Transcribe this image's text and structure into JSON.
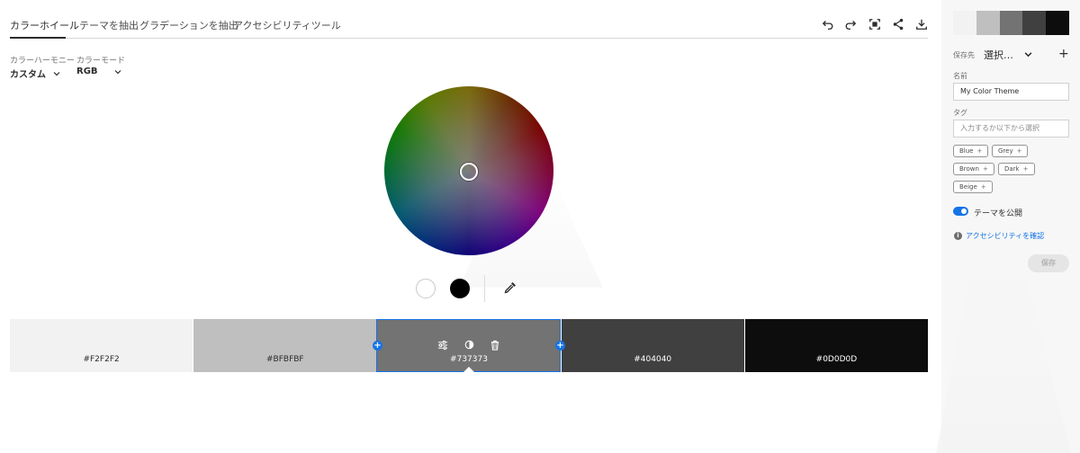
{
  "tabs": [
    {
      "label": "カラーホイール",
      "active": true
    },
    {
      "label": "テーマを抽出",
      "active": false
    },
    {
      "label": "グラデーションを抽出",
      "active": false
    },
    {
      "label": "アクセシビリティツール",
      "active": false
    }
  ],
  "toolbar": {
    "icons": [
      "undo-icon",
      "redo-icon",
      "fullscreen-icon",
      "share-icon",
      "download-icon"
    ]
  },
  "harmony": {
    "label": "カラーハーモニー",
    "value": "カスタム"
  },
  "mode": {
    "label": "カラーモード",
    "value": "RGB"
  },
  "wheel": {
    "base_colors": [
      {
        "name": "white",
        "color": "#FFFFFF"
      },
      {
        "name": "black",
        "color": "#000000"
      }
    ]
  },
  "swatches": [
    {
      "hex": "#F2F2F2",
      "color": "#F2F2F2",
      "text_color": "#2c2c2c",
      "selected": false
    },
    {
      "hex": "#BFBFBF",
      "color": "#BFBFBF",
      "text_color": "#2c2c2c",
      "selected": false
    },
    {
      "hex": "#737373",
      "color": "#737373",
      "text_color": "#ffffff",
      "selected": true
    },
    {
      "hex": "#404040",
      "color": "#404040",
      "text_color": "#ffffff",
      "selected": false
    },
    {
      "hex": "#0D0D0D",
      "color": "#0D0D0D",
      "text_color": "#ffffff",
      "selected": false
    }
  ],
  "selected_tools": [
    "sliders-icon",
    "contrast-icon",
    "trash-icon"
  ],
  "panel": {
    "save_to_label": "保存先",
    "save_to_value": "選択…",
    "name_label": "名前",
    "name_value": "My Color Theme",
    "tags_label": "タグ",
    "tags_placeholder": "入力するか以下から選択",
    "tags": [
      "Blue",
      "Grey",
      "Brown",
      "Dark",
      "Beige"
    ],
    "publish_label": "テーマを公開",
    "publish_on": true,
    "accessibility_link": "アクセシビリティを確認",
    "save_button": "保存"
  },
  "colors": {
    "accent": "#1473e6",
    "text": "#2c2c2c"
  }
}
